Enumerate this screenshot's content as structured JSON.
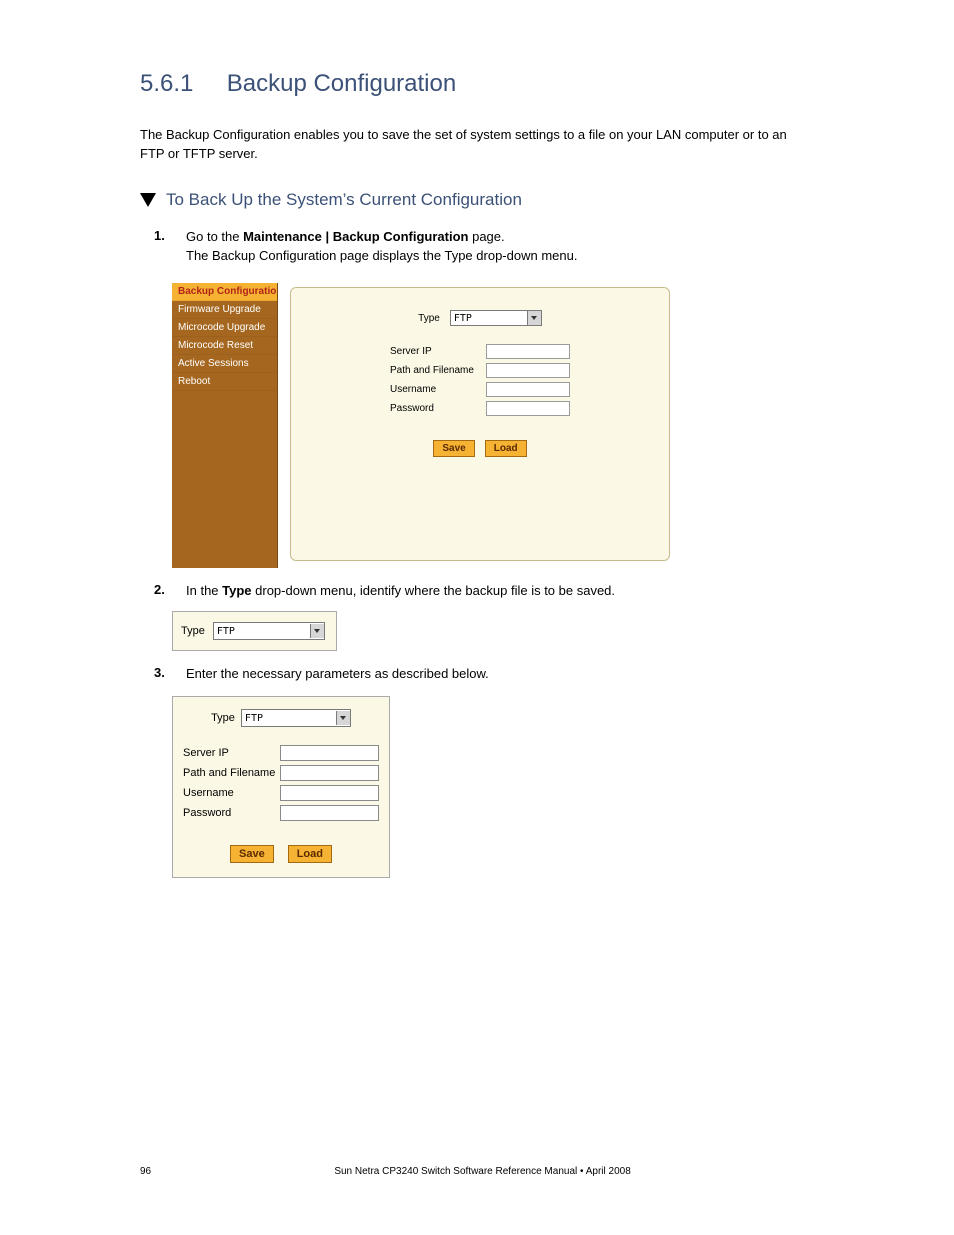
{
  "section_number": "5.6.1",
  "section_title": "Backup Configuration",
  "intro_text": "The Backup Configuration enables you to save the set of system settings to a file on your LAN computer or to an FTP or TFTP server.",
  "procedure_title": "To Back Up the System’s Current Configuration",
  "steps": {
    "s1": {
      "num": "1.",
      "text_a": "Go to the ",
      "text_b": "Maintenance | Backup Configuration",
      "text_c": " page.",
      "text_d": "The Backup Configuration page displays the Type drop-down menu."
    },
    "s2": {
      "num": "2.",
      "text_a": "In the ",
      "text_b": "Type",
      "text_c": " drop-down menu, identify where the backup file is to be saved."
    },
    "s3": {
      "num": "3.",
      "text_a": "Enter the necessary parameters as described below."
    }
  },
  "figure_main": {
    "sidebar": [
      {
        "label": "Backup Configuration",
        "active": true
      },
      {
        "label": "Firmware Upgrade",
        "active": false
      },
      {
        "label": "Microcode Upgrade",
        "active": false
      },
      {
        "label": "Microcode Reset",
        "active": false
      },
      {
        "label": "Active Sessions",
        "active": false
      },
      {
        "label": "Reboot",
        "active": false
      }
    ],
    "type_label": "Type",
    "type_value": "FTP",
    "fields": {
      "server_ip": "Server IP",
      "path": "Path and Filename",
      "username": "Username",
      "password": "Password"
    },
    "buttons": {
      "save": "Save",
      "load": "Load"
    }
  },
  "figure_type": {
    "label": "Type",
    "value": "FTP"
  },
  "figure_form": {
    "type_label": "Type",
    "type_value": "FTP",
    "fields": {
      "server_ip": "Server IP",
      "path": "Path and Filename",
      "username": "Username",
      "password": "Password"
    },
    "buttons": {
      "save": "Save",
      "load": "Load"
    }
  },
  "footer": {
    "left": "96",
    "center": "Sun Netra CP3240 Switch Software Reference Manual • April 2008",
    "right": ""
  }
}
